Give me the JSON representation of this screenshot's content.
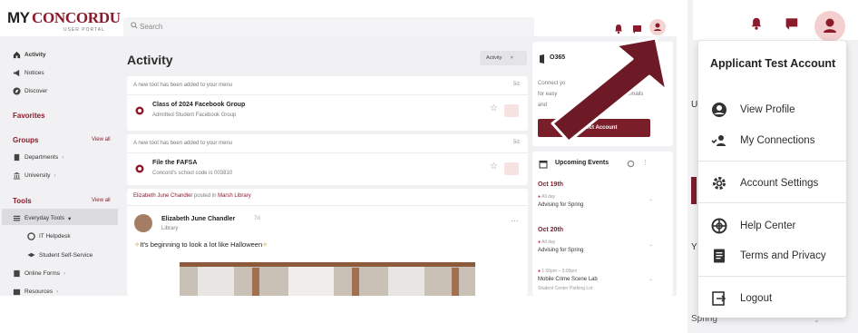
{
  "app": {
    "logo_my": "MY",
    "logo_brand": "CONCORDU",
    "logo_portal": "USER PORTAL"
  },
  "search": {
    "placeholder": "Search"
  },
  "sidebar": {
    "items": [
      {
        "label": "Activity"
      },
      {
        "label": "Notices"
      },
      {
        "label": "Discover"
      }
    ],
    "favorites": "Favorites",
    "groups": {
      "title": "Groups",
      "view_all": "View all",
      "items": [
        {
          "label": "Departments"
        },
        {
          "label": "University"
        }
      ]
    },
    "tools": {
      "title": "Tools",
      "view_all": "View all",
      "items": [
        {
          "label": "Everyday Tools"
        },
        {
          "label": "IT Helpdesk"
        },
        {
          "label": "Student Self-Service"
        },
        {
          "label": "Online Forms"
        },
        {
          "label": "Resources"
        }
      ]
    }
  },
  "main": {
    "title": "Activity",
    "filter": "Activity",
    "cards": [
      {
        "note": "A new tool has been added to your menu",
        "title": "Class of 2024 Facebook Group",
        "sub": "Admitted Student Facebook Group"
      },
      {
        "note": "A new tool has been added to your menu",
        "title": "File the FAFSA",
        "sub": "Concord's school code is 003810"
      }
    ],
    "post": {
      "note_user": "Elizabeth June Chandler",
      "note_mid": " posted in ",
      "note_place": "Marsh Library",
      "author": "Elizabeth June Chandler",
      "time": "7d",
      "location": "Library",
      "text": "It's beginning to look a lot like Halloween"
    }
  },
  "right": {
    "o365": "O365",
    "connect_lines": [
      "Connect yo",
      "for easy",
      "and"
    ],
    "connect_right": [
      "ccount",
      "emails"
    ],
    "connect_button": "Connect Account",
    "events_title": "Upcoming Events",
    "events": [
      {
        "date": "Oct 19th",
        "meta": "All day",
        "name": "Advising for Spring"
      },
      {
        "date": "Oct 20th",
        "meta": "All day",
        "name": "Advising for Spring"
      },
      {
        "meta": "1:00pm – 3:00pm",
        "name": "Mobile Crime Scene Lab",
        "loc": "Student Center Parking Lot"
      }
    ]
  },
  "dropdown": {
    "name": "Applicant Test Account",
    "items": [
      {
        "label": "View Profile",
        "icon": "account-circle-icon"
      },
      {
        "label": "My Connections",
        "icon": "connections-icon"
      },
      {
        "label": "Account Settings",
        "icon": "gear-icon"
      },
      {
        "label": "Help Center",
        "icon": "help-center-icon"
      },
      {
        "label": "Terms and Privacy",
        "icon": "document-icon"
      },
      {
        "label": "Logout",
        "icon": "logout-icon"
      }
    ],
    "behind_letters": [
      "U",
      "Y"
    ],
    "spring": "Spring"
  },
  "colors": {
    "accent": "#8b1a2a",
    "arrow": "#6e1a26",
    "avatar_bg": "#f4d3d3"
  }
}
